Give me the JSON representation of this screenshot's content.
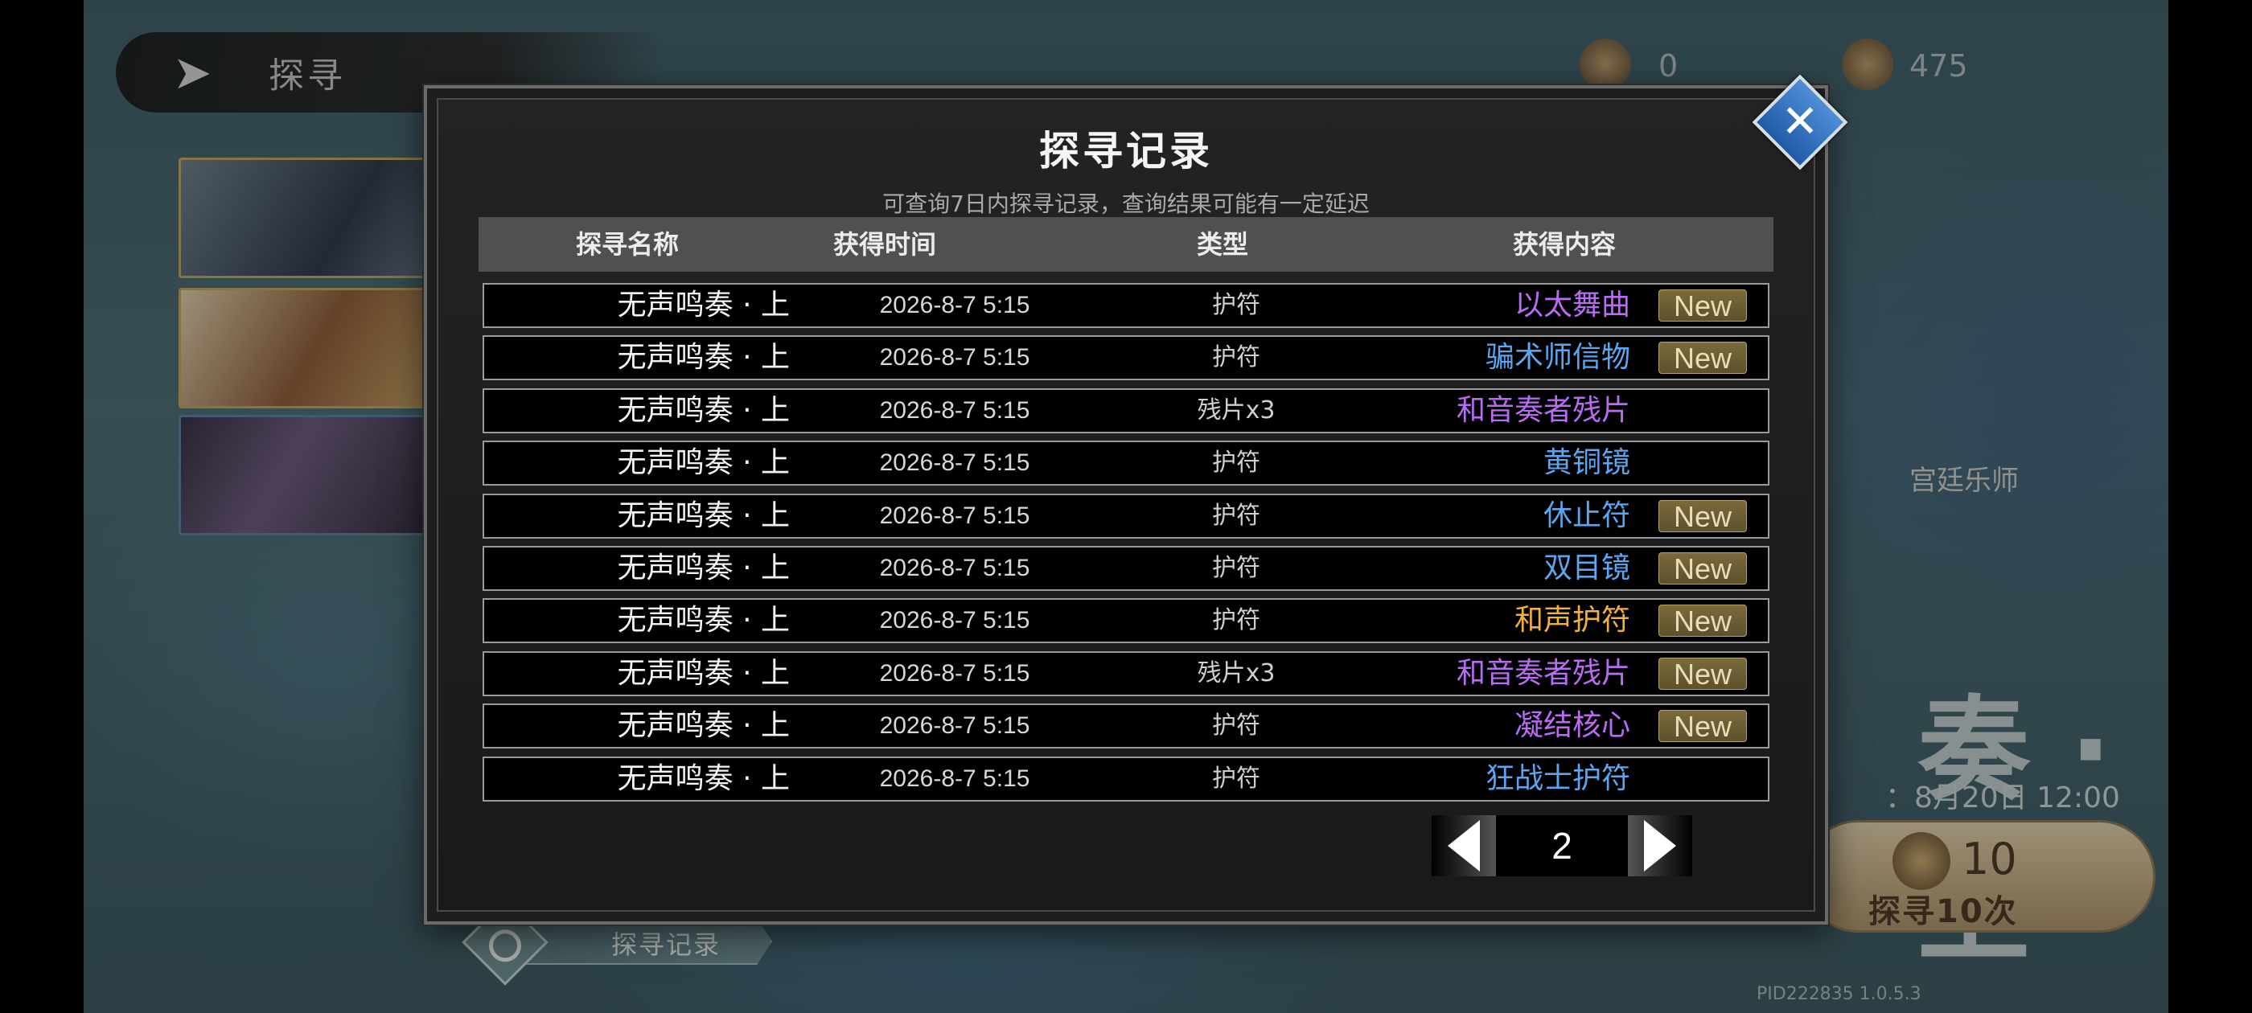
{
  "background": {
    "title": "探寻",
    "currency_1": "0",
    "currency_2": "475",
    "side_label": "宫廷乐师",
    "big_char": "奏 · 上",
    "deadline": "：8月20日 12:00",
    "draw10_count": "10",
    "draw10_label": "探寻10次",
    "record_button_label": "探寻记录",
    "pid": "PID222835  1.0.5.3"
  },
  "modal": {
    "title": "探寻记录",
    "subtitle": "可查询7日内探寻记录，查询结果可能有一定延迟",
    "headers": {
      "name": "探寻名称",
      "time": "获得时间",
      "type": "类型",
      "content": "获得内容"
    },
    "rows": [
      {
        "name": "无声鸣奏 · 上",
        "time": "2026-8-7 5:15",
        "type": "护符",
        "item": "以太舞曲",
        "item_color": "#b86cf2",
        "new": "New"
      },
      {
        "name": "无声鸣奏 · 上",
        "time": "2026-8-7 5:15",
        "type": "护符",
        "item": "骗术师信物",
        "item_color": "#5aa6f0",
        "new": "New"
      },
      {
        "name": "无声鸣奏 · 上",
        "time": "2026-8-7 5:15",
        "type": "残片x3",
        "item": "和音奏者残片",
        "item_color": "#b86cf2",
        "new": ""
      },
      {
        "name": "无声鸣奏 · 上",
        "time": "2026-8-7 5:15",
        "type": "护符",
        "item": "黄铜镜",
        "item_color": "#5aa6f0",
        "new": ""
      },
      {
        "name": "无声鸣奏 · 上",
        "time": "2026-8-7 5:15",
        "type": "护符",
        "item": "休止符",
        "item_color": "#5aa6f0",
        "new": "New"
      },
      {
        "name": "无声鸣奏 · 上",
        "time": "2026-8-7 5:15",
        "type": "护符",
        "item": "双目镜",
        "item_color": "#5aa6f0",
        "new": "New"
      },
      {
        "name": "无声鸣奏 · 上",
        "time": "2026-8-7 5:15",
        "type": "护符",
        "item": "和声护符",
        "item_color": "#f2b13a",
        "new": "New"
      },
      {
        "name": "无声鸣奏 · 上",
        "time": "2026-8-7 5:15",
        "type": "残片x3",
        "item": "和音奏者残片",
        "item_color": "#b86cf2",
        "new": "New"
      },
      {
        "name": "无声鸣奏 · 上",
        "time": "2026-8-7 5:15",
        "type": "护符",
        "item": "凝结核心",
        "item_color": "#b86cf2",
        "new": "New"
      },
      {
        "name": "无声鸣奏 · 上",
        "time": "2026-8-7 5:15",
        "type": "护符",
        "item": "狂战士护符",
        "item_color": "#5aa6f0",
        "new": ""
      }
    ],
    "pager": {
      "page": "2"
    },
    "close_icon": "close-icon"
  }
}
